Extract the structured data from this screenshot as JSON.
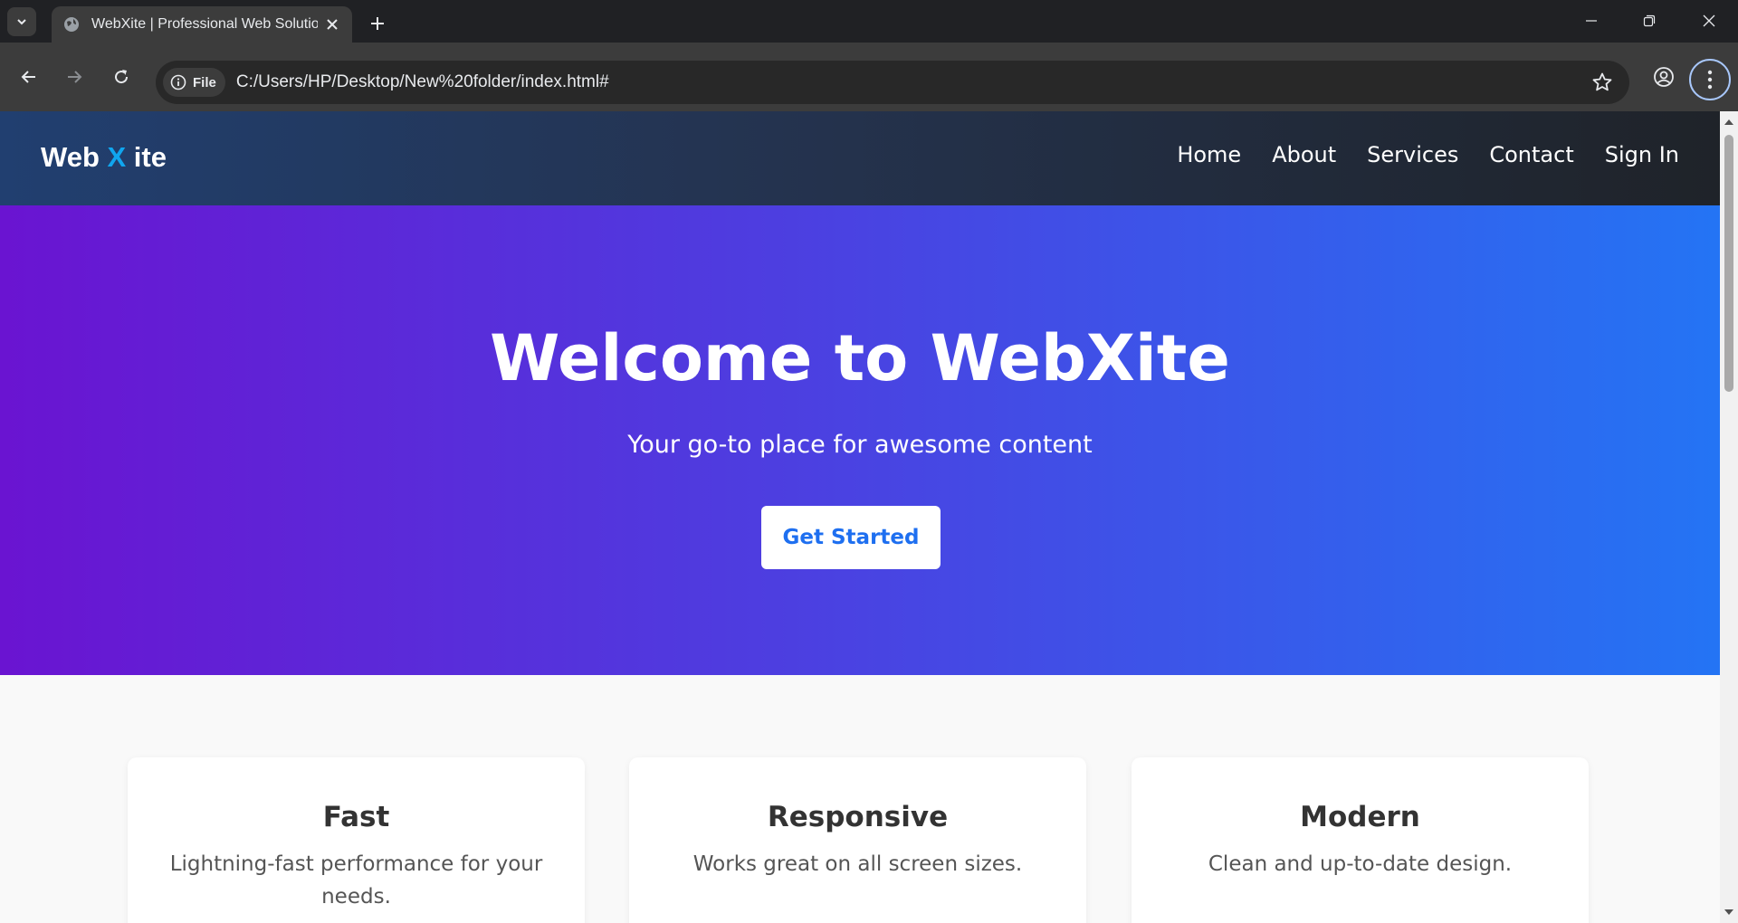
{
  "browser": {
    "tab_title": "WebXite | Professional Web Solutions",
    "chip_label": "File",
    "url": "C:/Users/HP/Desktop/New%20folder/index.html#"
  },
  "site": {
    "logo": {
      "part1": "Web ",
      "part2": "X",
      "part3": " ite"
    },
    "nav": [
      "Home",
      "About",
      "Services",
      "Contact",
      "Sign In"
    ]
  },
  "hero": {
    "title": "Welcome to WebXite",
    "subtitle": "Your go-to place for awesome content",
    "cta_label": "Get Started"
  },
  "features": [
    {
      "title": "Fast",
      "text": "Lightning-fast performance for your needs."
    },
    {
      "title": "Responsive",
      "text": "Works great on all screen sizes."
    },
    {
      "title": "Modern",
      "text": "Clean and up-to-date design."
    }
  ],
  "colors": {
    "accent_blue": "#1e6ff0",
    "logo_x": "#10a6ef",
    "hero_start": "#6a14d1",
    "hero_end": "#2474f4"
  },
  "icons": [
    "tab-search-icon",
    "globe-icon",
    "close-icon",
    "plus-icon",
    "minimize-icon",
    "restore-icon",
    "window-close-icon",
    "back-arrow-icon",
    "forward-arrow-icon",
    "reload-icon",
    "info-icon",
    "star-icon",
    "profile-icon",
    "kebab-menu-icon"
  ]
}
